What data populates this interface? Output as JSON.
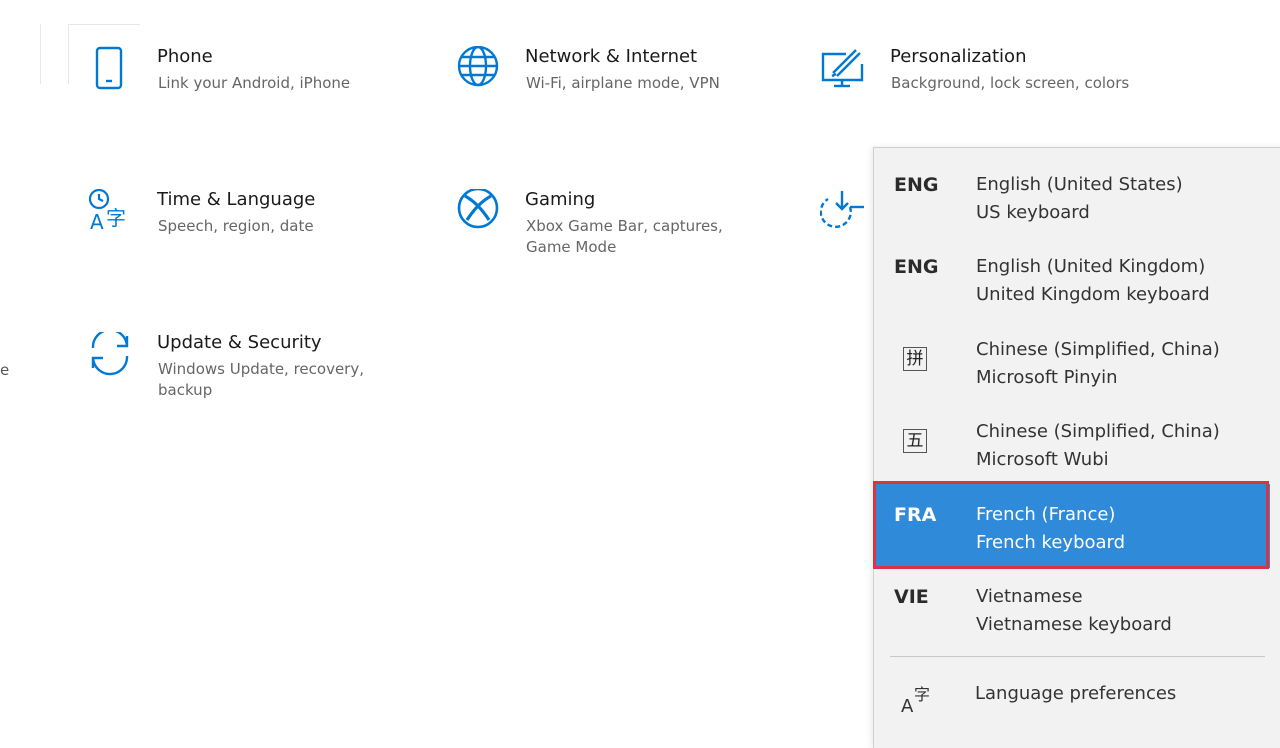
{
  "colors": {
    "accent": "#0078d4",
    "selected_bg": "#2f8ad9",
    "highlight_outline": "#d9343f"
  },
  "left_edge_text": "e",
  "tiles": [
    {
      "icon": "phone-icon",
      "title": "Phone",
      "sub": "Link your Android, iPhone"
    },
    {
      "icon": "globe-icon",
      "title": "Network & Internet",
      "sub": "Wi-Fi, airplane mode, VPN"
    },
    {
      "icon": "personalization-icon",
      "title": "Personalization",
      "sub": "Background, lock screen, colors"
    },
    {
      "icon": "time-language-icon",
      "title": "Time & Language",
      "sub": "Speech, region, date"
    },
    {
      "icon": "xbox-icon",
      "title": "Gaming",
      "sub": "Xbox Game Bar, captures, Game Mode"
    },
    {
      "icon": "update-icon",
      "title": "Update & Security",
      "sub": "Windows Update, recovery, backup"
    }
  ],
  "languages": [
    {
      "code": "ENG",
      "name": "English (United States)",
      "keyboard": "US keyboard"
    },
    {
      "code": "ENG",
      "name": "English (United Kingdom)",
      "keyboard": "United Kingdom keyboard"
    },
    {
      "glyph": "拼",
      "name": "Chinese (Simplified, China)",
      "keyboard": "Microsoft Pinyin"
    },
    {
      "glyph": "五",
      "name": "Chinese (Simplified, China)",
      "keyboard": "Microsoft Wubi"
    },
    {
      "code": "FRA",
      "name": "French (France)",
      "keyboard": "French keyboard",
      "selected": true
    },
    {
      "code": "VIE",
      "name": "Vietnamese",
      "keyboard": "Vietnamese keyboard"
    }
  ],
  "preferences_label": "Language preferences"
}
